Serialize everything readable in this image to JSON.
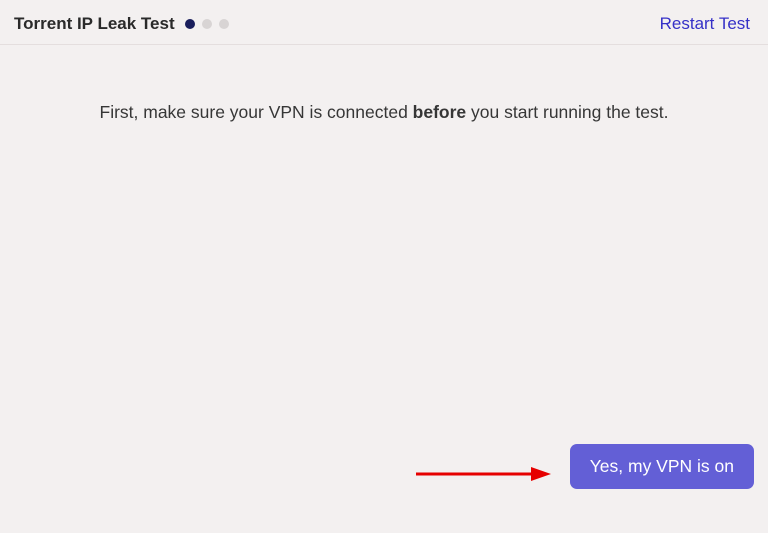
{
  "header": {
    "title": "Torrent IP Leak Test",
    "restart_label": "Restart Test",
    "steps": {
      "current": 1,
      "total": 3
    }
  },
  "instruction": {
    "prefix": "First, make sure your VPN is connected ",
    "bold": "before",
    "suffix": " you start running the test."
  },
  "confirm_label": "Yes, my VPN is on",
  "colors": {
    "accent": "#635fd6",
    "link": "#3530c7",
    "dot_active": "#191d5b",
    "dot_inactive": "#d8d4d4",
    "arrow": "#e60000"
  }
}
